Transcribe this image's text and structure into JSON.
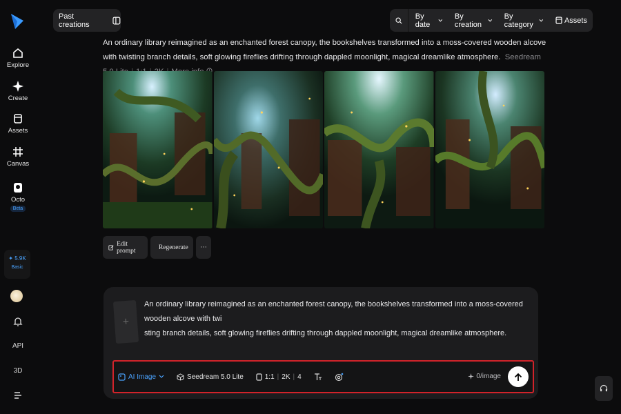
{
  "sidebar": {
    "nav": [
      {
        "label": "Explore",
        "icon": "home-icon"
      },
      {
        "label": "Create",
        "icon": "sparkle-icon"
      },
      {
        "label": "Assets",
        "icon": "folder-icon"
      },
      {
        "label": "Canvas",
        "icon": "canvas-icon"
      },
      {
        "label": "Octo",
        "icon": "octo-icon",
        "badge": "Beta"
      }
    ],
    "credits": {
      "amount": "✦ 5.9K",
      "tier": "Basic"
    },
    "bottom": {
      "api_label": "API",
      "three_d_label": "3D"
    }
  },
  "header": {
    "past_creations_label": "Past creations",
    "filters": [
      "By date",
      "By creation",
      "By category"
    ],
    "assets_label": "Assets"
  },
  "generation": {
    "prompt": "An ordinary library reimagined as an enchanted forest canopy, the bookshelves transformed into a moss-covered wooden alcove with twisting branch details, soft glowing fireflies drifting through dappled moonlight, magical dreamlike atmosphere.",
    "model": "Seedream 5.0 Lite",
    "ratio": "1:1",
    "resolution": "2K",
    "more_info": "More info",
    "actions": {
      "edit": "Edit prompt",
      "regenerate": "Regenerate",
      "more": "···"
    }
  },
  "composer": {
    "text_line1": "An ordinary library reimagined as an enchanted forest canopy, the bookshelves transformed into a moss-covered wooden alcove with twi",
    "text_line2": "sting branch details, soft glowing fireflies drifting through dappled moonlight, magical dreamlike atmosphere.",
    "mode": "AI Image",
    "model": "Seedream 5.0 Lite",
    "ratio": "1:1",
    "resolution": "2K",
    "count": "4",
    "quota": "0/image"
  },
  "colors": {
    "accent": "#4aa3ff",
    "highlight_border": "#d2232a",
    "panel": "#232325"
  }
}
